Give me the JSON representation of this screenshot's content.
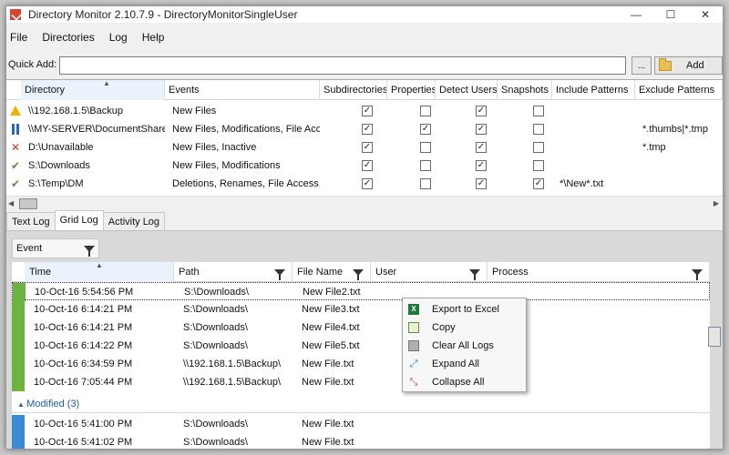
{
  "window": {
    "title": "Directory Monitor 2.10.7.9 - DirectoryMonitorSingleUser",
    "controls": [
      "—",
      "☐",
      "✕"
    ]
  },
  "menu": [
    "File",
    "Directories",
    "Log",
    "Help"
  ],
  "quick_add": {
    "label": "Quick Add:",
    "value": "",
    "browse_label": "...",
    "add_label": "Add"
  },
  "directories": {
    "columns": [
      "Directory",
      "Events",
      "Subdirectories",
      "Properties",
      "Detect Users",
      "Snapshots",
      "Include Patterns",
      "Exclude Patterns"
    ],
    "rows": [
      {
        "status": "warning-icon",
        "directory": "\\\\192.168.1.5\\Backup",
        "events": "New Files",
        "subdirectories": true,
        "properties": false,
        "detect_users": true,
        "snapshots": false,
        "include": "",
        "exclude": ""
      },
      {
        "status": "pause-icon",
        "directory": "\\\\MY-SERVER\\DocumentShare",
        "events": "New Files, Modifications, File Access",
        "subdirectories": true,
        "properties": true,
        "detect_users": true,
        "snapshots": false,
        "include": "",
        "exclude": "*.thumbs|*.tmp"
      },
      {
        "status": "error-icon",
        "directory": "D:\\Unavailable",
        "events": "New Files, Inactive",
        "subdirectories": true,
        "properties": false,
        "detect_users": true,
        "snapshots": false,
        "include": "",
        "exclude": "*.tmp"
      },
      {
        "status": "check-icon",
        "directory": "S:\\Downloads",
        "events": "New Files, Modifications",
        "subdirectories": true,
        "properties": false,
        "detect_users": true,
        "snapshots": false,
        "include": "",
        "exclude": ""
      },
      {
        "status": "check-icon",
        "directory": "S:\\Temp\\DM",
        "events": "Deletions, Renames, File Access, In...",
        "subdirectories": true,
        "properties": false,
        "detect_users": true,
        "snapshots": true,
        "include": "*\\New*.txt",
        "exclude": ""
      }
    ]
  },
  "tabs": [
    "Text Log",
    "Grid Log",
    "Activity Log"
  ],
  "active_tab": "Grid Log",
  "group_by": "Event",
  "log": {
    "columns": [
      "Time",
      "Path",
      "File Name",
      "User",
      "Process"
    ],
    "rows": [
      {
        "color": "#6cb33f",
        "time": "10-Oct-16 5:54:56 PM",
        "path": "S:\\Downloads\\",
        "file": "New File2.txt"
      },
      {
        "color": "#6cb33f",
        "time": "10-Oct-16 6:14:21 PM",
        "path": "S:\\Downloads\\",
        "file": "New File3.txt"
      },
      {
        "color": "#6cb33f",
        "time": "10-Oct-16 6:14:21 PM",
        "path": "S:\\Downloads\\",
        "file": "New File4.txt"
      },
      {
        "color": "#6cb33f",
        "time": "10-Oct-16 6:14:22 PM",
        "path": "S:\\Downloads\\",
        "file": "New File5.txt"
      },
      {
        "color": "#6cb33f",
        "time": "10-Oct-16 6:34:59 PM",
        "path": "\\\\192.168.1.5\\Backup\\",
        "file": "New File.txt"
      },
      {
        "color": "#6cb33f",
        "time": "10-Oct-16 7:05:44 PM",
        "path": "\\\\192.168.1.5\\Backup\\",
        "file": "New File.txt"
      }
    ],
    "group_label": "Modified (3)",
    "group_rows": [
      {
        "color": "#3a8ad6",
        "time": "10-Oct-16 5:41:00 PM",
        "path": "S:\\Downloads\\",
        "file": "New File.txt"
      },
      {
        "color": "#3a8ad6",
        "time": "10-Oct-16 5:41:02 PM",
        "path": "S:\\Downloads\\",
        "file": "New File.txt"
      }
    ]
  },
  "context_menu": [
    "Export to Excel",
    "Copy",
    "Clear All Logs",
    "Expand All",
    "Collapse All"
  ]
}
